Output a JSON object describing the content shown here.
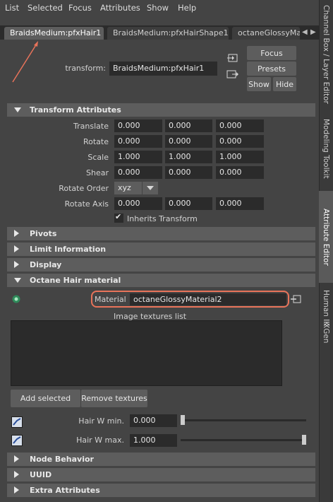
{
  "menu": [
    "List",
    "Selected",
    "Focus",
    "Attributes",
    "Show",
    "Help"
  ],
  "tabs": [
    "BraidsMedium:pfxHair1",
    "BraidsMedium:pfxHairShape1",
    "octaneGlossyMa"
  ],
  "side_tabs": [
    "Channel Box / Layer Editor",
    "Modeling Toolkit",
    "Attribute Editor",
    "Human IK",
    "XGen"
  ],
  "header": {
    "transform_label": "transform:",
    "transform_value": "BraidsMedium:pfxHair1",
    "focus": "Focus",
    "presets": "Presets",
    "show": "Show",
    "hide": "Hide"
  },
  "transform": {
    "title": "Transform Attributes",
    "rows": [
      {
        "label": "Translate",
        "values": [
          "0.000",
          "0.000",
          "0.000"
        ]
      },
      {
        "label": "Rotate",
        "values": [
          "0.000",
          "0.000",
          "0.000"
        ]
      },
      {
        "label": "Scale",
        "values": [
          "1.000",
          "1.000",
          "1.000"
        ]
      },
      {
        "label": "Shear",
        "values": [
          "0.000",
          "0.000",
          "0.000"
        ]
      }
    ],
    "rotate_order_label": "Rotate Order",
    "rotate_order_value": "xyz",
    "rotate_axis_label": "Rotate Axis",
    "rotate_axis_values": [
      "0.000",
      "0.000",
      "0.000"
    ],
    "inherits_label": "Inherits Transform",
    "inherits_checked": true
  },
  "sections": {
    "pivots": "Pivots",
    "limit": "Limit Information",
    "display": "Display",
    "octane": "Octane Hair material",
    "node_behavior": "Node Behavior",
    "uuid": "UUID",
    "extra": "Extra Attributes"
  },
  "octane": {
    "material_label": "Material",
    "material_value": "octaneGlossyMaterial2",
    "textures_list_label": "Image textures list",
    "add_selected": "Add selected",
    "remove_textures": "Remove textures",
    "hair_w_min_label": "Hair W min.",
    "hair_w_min_value": "0.000",
    "hair_w_min_fraction": 0.0,
    "hair_w_max_label": "Hair W max.",
    "hair_w_max_value": "1.000",
    "hair_w_max_fraction": 1.0
  },
  "colors": {
    "highlight": "#e8735a",
    "panel": "#444444",
    "field": "#2b2b2b",
    "section": "#5d5d5d"
  }
}
